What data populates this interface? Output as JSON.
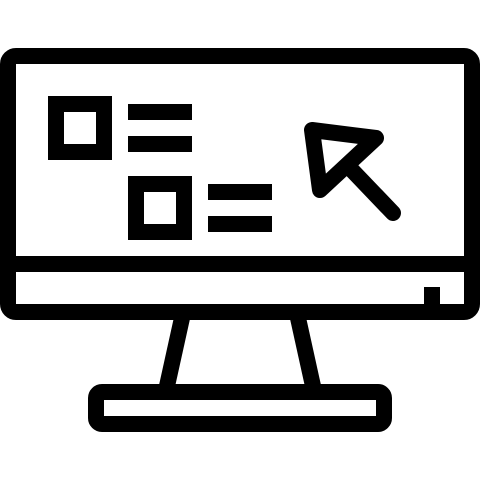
{
  "icon": {
    "name": "desktop-computer-icon",
    "stroke_color": "#000000",
    "background_color": "#ffffff",
    "components": [
      "monitor-frame-icon",
      "screen-icon",
      "bottom-bezel-icon",
      "power-indicator-icon",
      "checkbox-icon",
      "list-line-icon",
      "mouse-cursor-icon",
      "monitor-stand-icon",
      "monitor-base-icon"
    ]
  }
}
